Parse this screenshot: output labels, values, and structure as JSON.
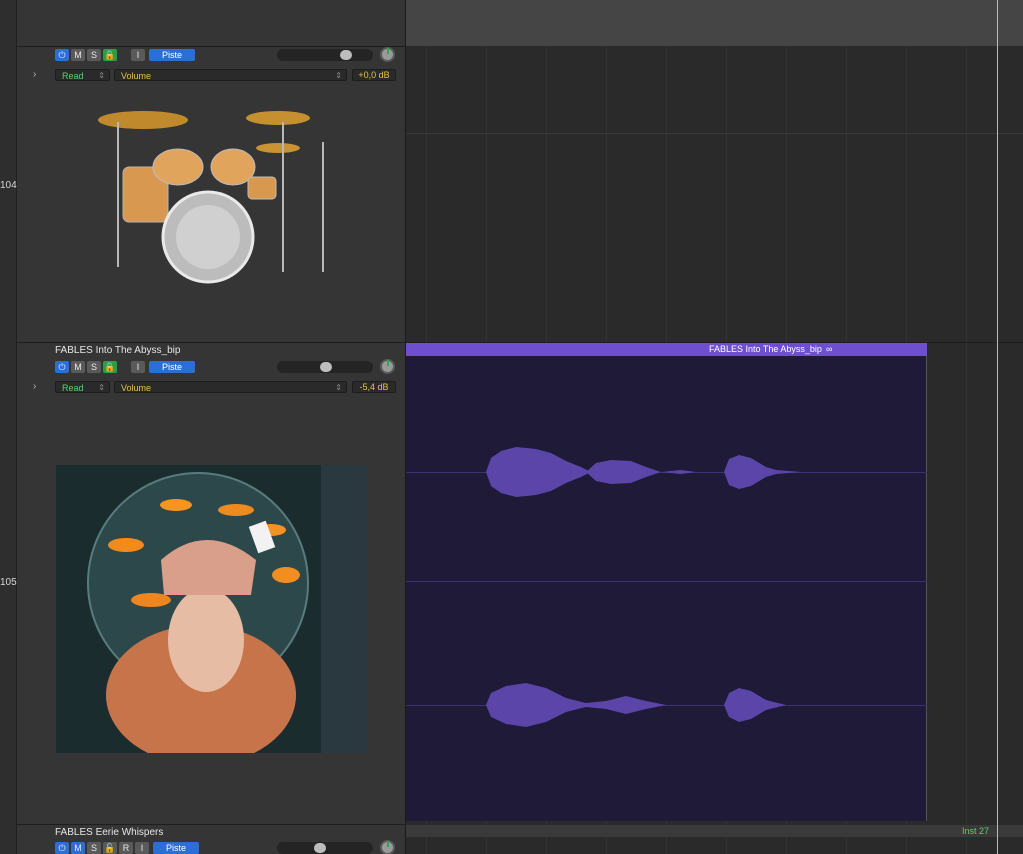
{
  "tracks": [
    {
      "number": "104",
      "name": "",
      "buttons": [
        "M",
        "S",
        "I"
      ],
      "track_label": "Piste",
      "automation_mode": "Read",
      "automation_param": "Volume",
      "volume": "+0,0 dB",
      "artwork": "drum-kit"
    },
    {
      "number": "105",
      "name": "FABLES Into The Abyss_bip",
      "buttons": [
        "M",
        "S",
        "I"
      ],
      "track_label": "Piste",
      "automation_mode": "Read",
      "automation_param": "Volume",
      "volume": "-5,4 dB",
      "artwork": "album-cover"
    },
    {
      "name": "FABLES Eerie Whispers",
      "buttons": [
        "M",
        "S",
        "R",
        "I"
      ],
      "track_label": "Piste"
    }
  ],
  "region": {
    "name": "FABLES Into The Abyss_bip",
    "color": "#6d4fd0"
  },
  "inst_label": "Inst 27",
  "colors": {
    "accent": "#2b6fd6",
    "region": "#6d4fd0",
    "automation_mode": "#5bd16b",
    "value": "#e3c24a"
  }
}
